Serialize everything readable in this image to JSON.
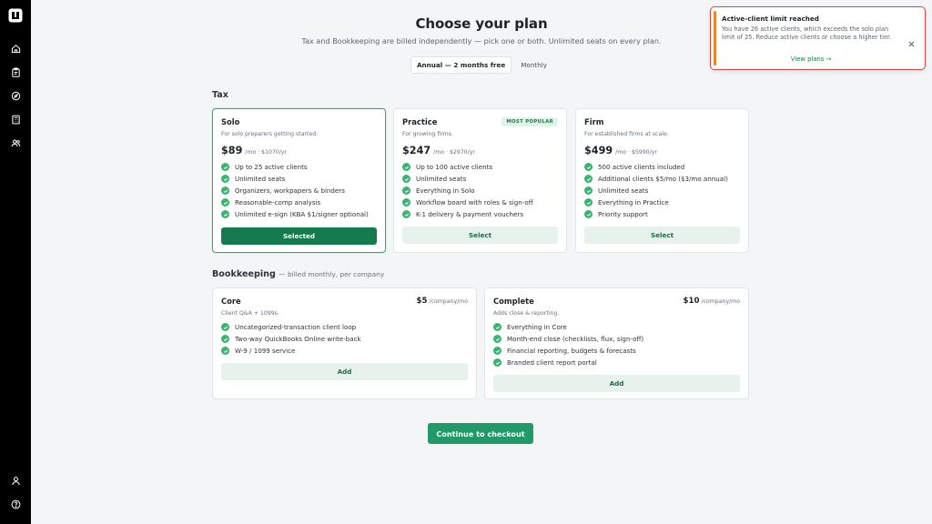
{
  "page": {
    "title": "Choose your plan",
    "subtitle": "Tax and Bookkeeping are billed independently — pick one or both. Unlimited seats on every plan."
  },
  "billing_toggle": {
    "annual_label": "Annual — 2 months free",
    "monthly_label": "Monthly",
    "selected": "annual"
  },
  "tax": {
    "section_label": "Tax",
    "plans": [
      {
        "name": "Solo",
        "desc": "For solo preparers getting started.",
        "price": "$89",
        "price_unit": "/mo · $1070/yr",
        "features": [
          "Up to 25 active clients",
          "Unlimited seats",
          "Organizers, workpapers & binders",
          "Reasonable-comp analysis",
          "Unlimited e-sign (KBA $1/signer optional)"
        ],
        "button": "Selected",
        "selected": true
      },
      {
        "name": "Practice",
        "badge": "MOST POPULAR",
        "desc": "For growing firms.",
        "price": "$247",
        "price_unit": "/mo · $2970/yr",
        "features": [
          "Up to 100 active clients",
          "Unlimited seats",
          "Everything in Solo",
          "Workflow board with roles & sign-off",
          "K-1 delivery & payment vouchers"
        ],
        "button": "Select"
      },
      {
        "name": "Firm",
        "desc": "For established firms at scale.",
        "price": "$499",
        "price_unit": "/mo · $5990/yr",
        "features": [
          "500 active clients included",
          "Additional clients $5/mo ($3/mo annual)",
          "Unlimited seats",
          "Everything in Practice",
          "Priority support"
        ],
        "button": "Select"
      }
    ]
  },
  "bookkeeping": {
    "section_label": "Bookkeeping",
    "section_note": "— billed monthly, per company",
    "plans": [
      {
        "name": "Core",
        "price": "$5",
        "price_unit": "/company/mo",
        "desc": "Client Q&A + 1099s.",
        "features": [
          "Uncategorized-transaction client loop",
          "Two-way QuickBooks Online write-back",
          "W-9 / 1099 service"
        ],
        "button": "Add"
      },
      {
        "name": "Complete",
        "price": "$10",
        "price_unit": "/company/mo",
        "desc": "Adds close & reporting.",
        "features": [
          "Everything in Core",
          "Month-end close (checklists, flux, sign-off)",
          "Financial reporting, budgets & forecasts",
          "Branded client report portal"
        ],
        "button": "Add"
      }
    ]
  },
  "checkout_label": "Continue to checkout",
  "toast": {
    "title": "Active-client limit reached",
    "body": "You have 26 active clients, which exceeds the solo plan limit of 25. Reduce active clients or choose a higher tier.",
    "link": "View plans →"
  },
  "sidebar": {
    "nav_icons": [
      "home-icon",
      "clipboard-icon",
      "compass-icon",
      "calculator-icon",
      "users-icon"
    ],
    "footer_icons": [
      "user-icon",
      "help-icon"
    ]
  },
  "colors": {
    "brand_green": "#157a4d",
    "cta_green": "#1f9a68",
    "check_green": "#3bb472",
    "alert_red": "#d64545",
    "alert_accent": "#e8872a"
  }
}
